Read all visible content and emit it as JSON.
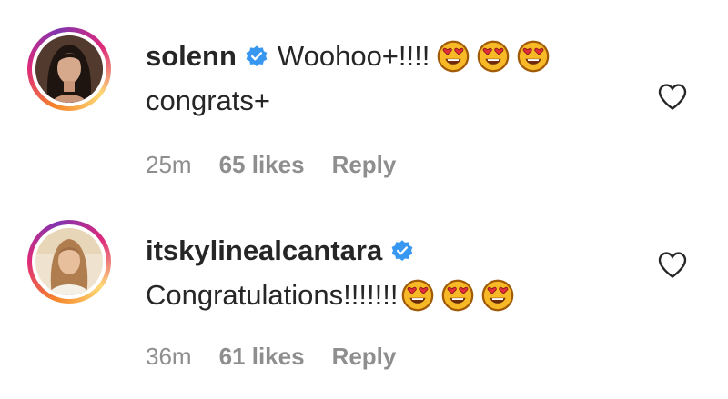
{
  "comments": [
    {
      "username": "solenn",
      "text_line1": "Woohoo+!!!!",
      "text_line2": "congrats+",
      "emojis": [
        "heart-eyes-emoji",
        "heart-eyes-emoji",
        "heart-eyes-emoji"
      ],
      "time": "25m",
      "likes": "65 likes",
      "reply_label": "Reply"
    },
    {
      "username": "itskylinealcantara",
      "text_line1": "",
      "text_line2": "Congratulations!!!!!!!",
      "emojis": [
        "heart-eyes-emoji",
        "heart-eyes-emoji",
        "heart-eyes-emoji"
      ],
      "time": "36m",
      "likes": "61 likes",
      "reply_label": "Reply"
    }
  ],
  "icons": {
    "verified": "verified-badge-icon",
    "like": "heart-outline-icon"
  },
  "colors": {
    "text": "#262626",
    "meta": "#8e8e8e",
    "verified": "#3897f0"
  }
}
